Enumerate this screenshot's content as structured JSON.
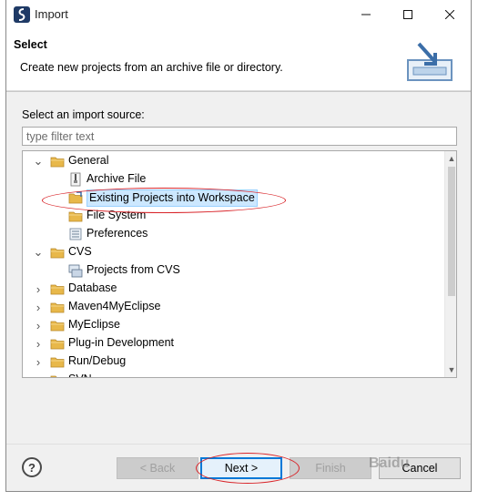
{
  "window": {
    "title": "Import",
    "minimize_glyph": "—",
    "maximize_glyph": "☐",
    "close_glyph": "✕"
  },
  "header": {
    "title": "Select",
    "description": "Create new projects from an archive file or directory.",
    "icon": "import-tray-icon"
  },
  "source": {
    "label": "Select an import source:",
    "filter_placeholder": "type filter text"
  },
  "tree": {
    "rows": [
      {
        "level": 0,
        "expanded": true,
        "label": "General",
        "icon": "folder-icon"
      },
      {
        "level": 1,
        "label": "Archive File",
        "icon": "archive-file-icon"
      },
      {
        "level": 1,
        "label": "Existing Projects into Workspace",
        "icon": "existing-projects-icon",
        "selected": true
      },
      {
        "level": 1,
        "label": "File System",
        "icon": "folder-icon"
      },
      {
        "level": 1,
        "label": "Preferences",
        "icon": "preferences-icon"
      },
      {
        "level": 0,
        "expanded": true,
        "label": "CVS",
        "icon": "folder-icon"
      },
      {
        "level": 1,
        "label": "Projects from CVS",
        "icon": "cvs-icon"
      },
      {
        "level": 0,
        "expanded": false,
        "label": "Database",
        "icon": "folder-icon"
      },
      {
        "level": 0,
        "expanded": false,
        "label": "Maven4MyEclipse",
        "icon": "folder-icon"
      },
      {
        "level": 0,
        "expanded": false,
        "label": "MyEclipse",
        "icon": "folder-icon"
      },
      {
        "level": 0,
        "expanded": false,
        "label": "Plug-in Development",
        "icon": "folder-icon"
      },
      {
        "level": 0,
        "expanded": false,
        "label": "Run/Debug",
        "icon": "folder-icon"
      },
      {
        "level": 0,
        "expanded": false,
        "label": "SVN",
        "icon": "folder-icon"
      }
    ]
  },
  "buttons": {
    "help": "?",
    "back": "< Back",
    "next": "Next >",
    "finish": "Finish",
    "cancel": "Cancel"
  },
  "watermark": "Baidu",
  "colors": {
    "selection": "#cce8ff",
    "folder": "#e8b84a",
    "annotation": "#d9252a",
    "default_button_border": "#0078d7"
  }
}
